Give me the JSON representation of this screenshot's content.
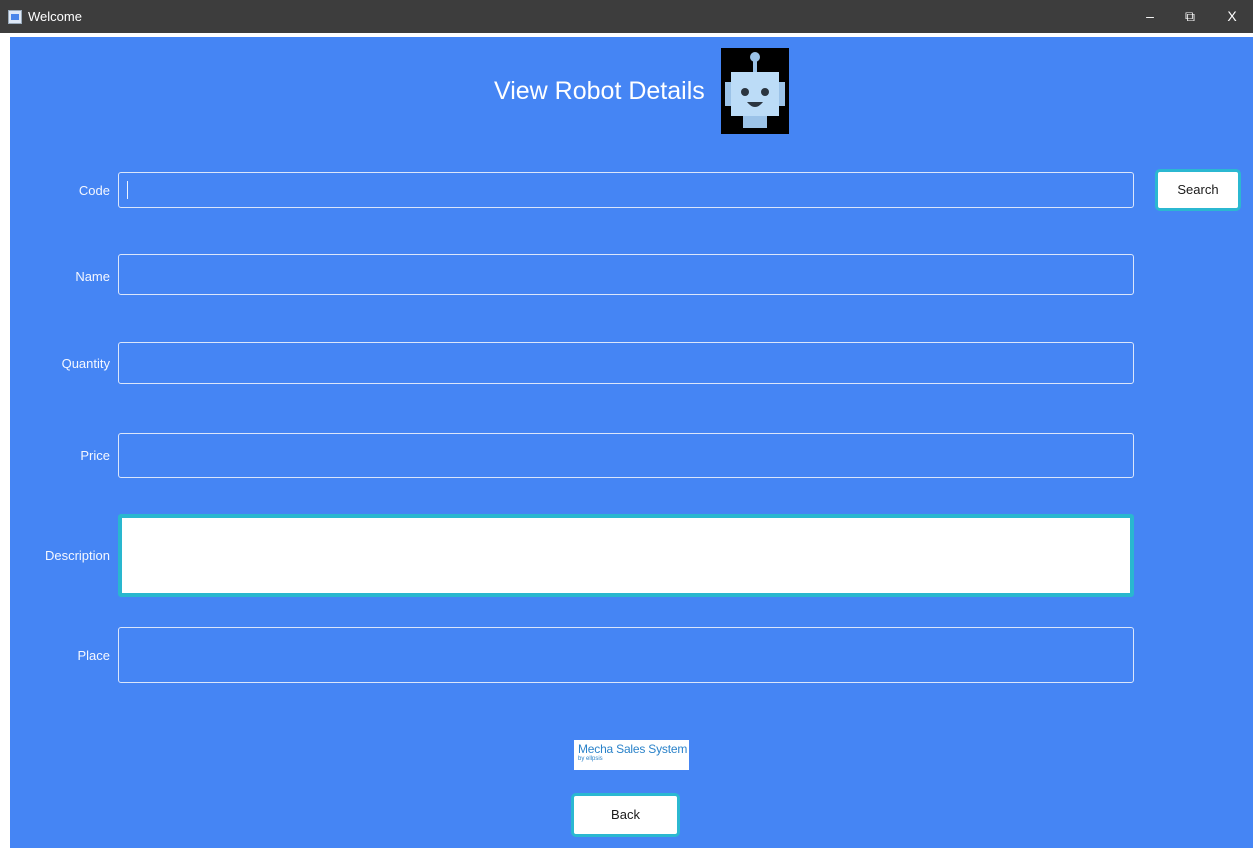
{
  "window": {
    "title": "Welcome",
    "controls": {
      "minimize": "–",
      "restore": "⧉",
      "close": "X"
    }
  },
  "page": {
    "heading": "View Robot Details"
  },
  "form": {
    "code_label": "Code",
    "name_label": "Name",
    "quantity_label": "Quantity",
    "price_label": "Price",
    "description_label": "Description",
    "place_label": "Place"
  },
  "buttons": {
    "search": "Search",
    "back": "Back"
  },
  "logo": {
    "line1": "Mecha Sales System",
    "line2": "by ellpsis"
  },
  "colors": {
    "background": "#4585f4",
    "titlebar": "#3d3d3d",
    "accent": "#29b7cf",
    "text": "#ffffff"
  }
}
